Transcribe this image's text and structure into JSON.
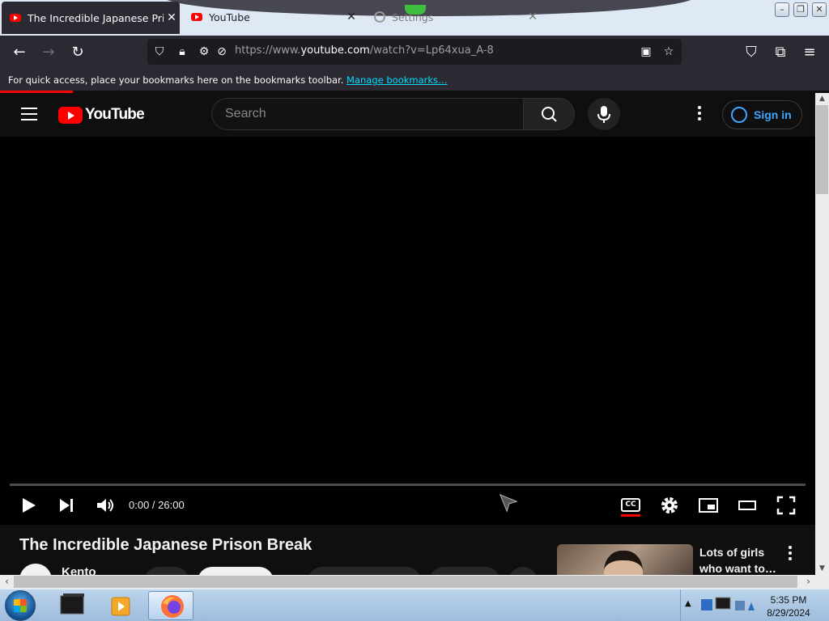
{
  "browser": {
    "tabs": [
      {
        "title": "The Incredible Japanese Prison Break",
        "close": "✕"
      },
      {
        "title": "YouTube",
        "close": "✕"
      },
      {
        "title": "Settings",
        "close": "✕"
      }
    ],
    "url_prefix": "https://www.",
    "url_host": "youtube.com",
    "url_path": "/watch?v=Lp64xua_A-8",
    "bookmarks_text": "For quick access, place your bookmarks here on the bookmarks toolbar.",
    "bookmarks_link": "Manage bookmarks…",
    "nav_icons": {
      "back": "back-arrow-icon",
      "forward": "forward-arrow-icon",
      "reload": "reload-icon"
    }
  },
  "youtube": {
    "logo_text": "YouTube",
    "search_placeholder": "Search",
    "sign_in": "Sign in",
    "player": {
      "time": "0:00 / 26:00",
      "cc_label": "CC",
      "progress_fraction": 0
    },
    "video_title": "The Incredible Japanese Prison Break",
    "channel_name": "Kento",
    "sidebar_video_title": "Lots of girls who want to…"
  },
  "taskbar": {
    "time": "5:35 PM",
    "date": "8/29/2024"
  },
  "colors": {
    "brand_red": "#ff0000",
    "link_blue": "#3ea6ff",
    "page_bg": "#0f0f0f"
  }
}
